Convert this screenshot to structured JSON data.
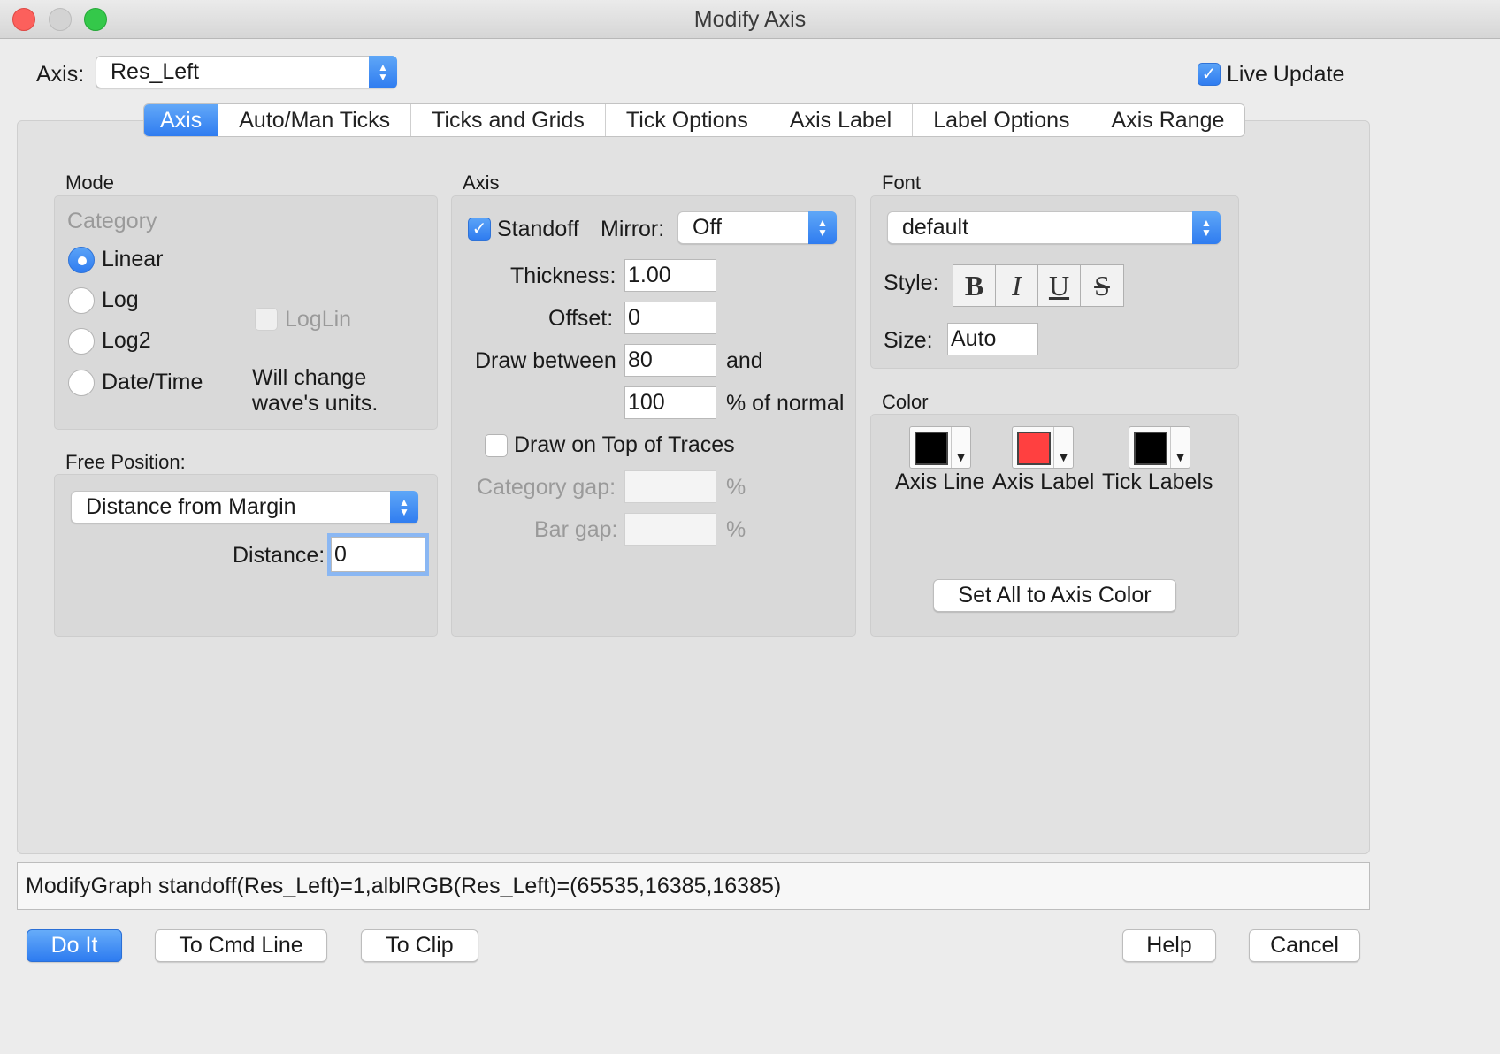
{
  "window": {
    "title": "Modify Axis"
  },
  "axis_select": {
    "label": "Axis:",
    "value": "Res_Left"
  },
  "live_update": {
    "label": "Live Update",
    "checked": true
  },
  "tabs": [
    "Axis",
    "Auto/Man Ticks",
    "Ticks and Grids",
    "Tick Options",
    "Axis Label",
    "Label Options",
    "Axis Range"
  ],
  "mode": {
    "heading": "Mode",
    "category_label": "Category",
    "options": [
      "Linear",
      "Log",
      "Log2",
      "Date/Time"
    ],
    "selected": "Linear",
    "loglin_label": "LogLin",
    "note_line1": "Will change",
    "note_line2": "wave's units."
  },
  "free_position": {
    "heading": "Free Position:",
    "select_value": "Distance from Margin",
    "distance_label": "Distance:",
    "distance_value": "0"
  },
  "axis_group": {
    "heading": "Axis",
    "standoff_label": "Standoff",
    "standoff_checked": true,
    "mirror_label": "Mirror:",
    "mirror_value": "Off",
    "thickness_label": "Thickness:",
    "thickness_value": "1.00",
    "offset_label": "Offset:",
    "offset_value": "0",
    "draw_between_label": "Draw between",
    "draw_between_from": "80",
    "and_label": "and",
    "draw_between_to": "100",
    "percent_normal_label": "% of normal",
    "draw_on_top_label": "Draw on Top of Traces",
    "category_gap_label": "Category gap:",
    "category_gap_value": "",
    "bar_gap_label": "Bar gap:",
    "bar_gap_value": "",
    "percent_sign": "%"
  },
  "font_group": {
    "heading": "Font",
    "font_value": "default",
    "style_label": "Style:",
    "style_buttons": [
      "B",
      "I",
      "U",
      "S"
    ],
    "size_label": "Size:",
    "size_value": "Auto"
  },
  "color_group": {
    "heading": "Color",
    "axis_line_label": "Axis Line",
    "axis_line_color": "#000000",
    "axis_label_label": "Axis Label",
    "axis_label_color": "#ff4040",
    "tick_labels_label": "Tick Labels",
    "tick_labels_color": "#000000",
    "set_all_button": "Set All to Axis Color"
  },
  "command_line": "ModifyGraph standoff(Res_Left)=1,alblRGB(Res_Left)=(65535,16385,16385)",
  "buttons": {
    "do_it": "Do It",
    "to_cmd_line": "To Cmd Line",
    "to_clip": "To Clip",
    "help": "Help",
    "cancel": "Cancel"
  }
}
